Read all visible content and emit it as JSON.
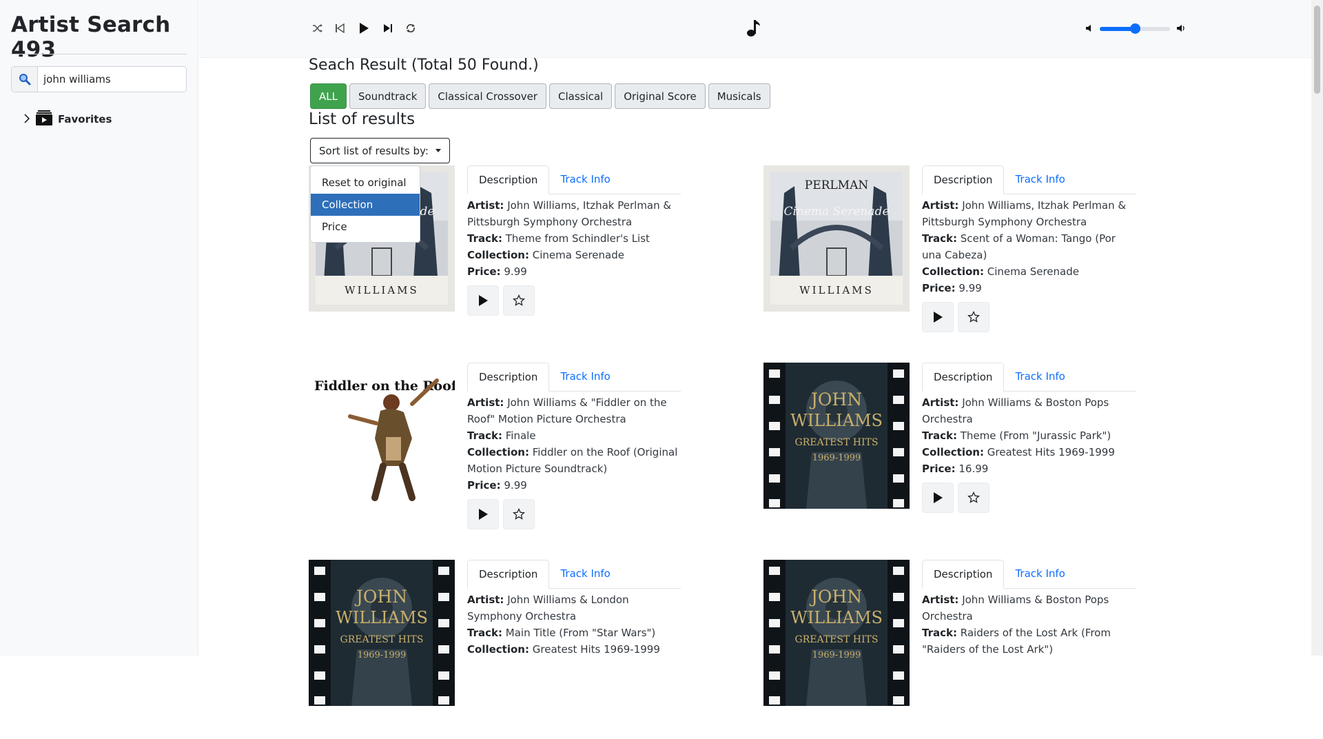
{
  "app": {
    "title": "Artist Search 493"
  },
  "search": {
    "value": "john williams",
    "icon": "search-icon"
  },
  "sidebar": {
    "favorites_label": "Favorites"
  },
  "player": {
    "volume_percent": 50
  },
  "results": {
    "heading": "Seach Result (Total 50 Found.)",
    "list_heading": "List of results",
    "filters": [
      "ALL",
      "Soundtrack",
      "Classical Crossover",
      "Classical",
      "Original Score",
      "Musicals"
    ],
    "active_filter": "ALL",
    "sort": {
      "label": "Sort list of results by:",
      "options": [
        "Reset to original",
        "Collection",
        "Price"
      ],
      "highlighted": "Collection"
    },
    "tab_labels": {
      "description": "Description",
      "track_info": "Track Info"
    },
    "field_labels": {
      "artist": "Artist:",
      "track": "Track:",
      "collection": "Collection:",
      "price": "Price:"
    },
    "cards": [
      {
        "artist": "John Williams, Itzhak Perlman & Pittsburgh Symphony Orchestra",
        "track": "Theme from Schindler's List",
        "collection": "Cinema Serenade",
        "price": "9.99",
        "cover": "cinema-serenade"
      },
      {
        "artist": "John Williams, Itzhak Perlman & Pittsburgh Symphony Orchestra",
        "track": "Scent of a Woman: Tango (Por una Cabeza)",
        "collection": "Cinema Serenade",
        "price": "9.99",
        "cover": "cinema-serenade"
      },
      {
        "artist": "John Williams & \"Fiddler on the Roof\" Motion Picture Orchestra",
        "track": "Finale",
        "collection": "Fiddler on the Roof (Original Motion Picture Soundtrack)",
        "price": "9.99",
        "cover": "fiddler"
      },
      {
        "artist": "John Williams & Boston Pops Orchestra",
        "track": "Theme (From \"Jurassic Park\")",
        "collection": "Greatest Hits 1969-1999",
        "price": "16.99",
        "cover": "greatest-hits"
      },
      {
        "artist": "John Williams & London Symphony Orchestra",
        "track": "Main Title (From \"Star Wars\")",
        "collection": "Greatest Hits 1969-1999",
        "price": "",
        "cover": "greatest-hits"
      },
      {
        "artist": "John Williams & Boston Pops Orchestra",
        "track": "Raiders of the Lost Ark (From \"Raiders of the Lost Ark\")",
        "collection": "",
        "price": "",
        "cover": "greatest-hits"
      }
    ]
  },
  "covers": {
    "cinema-serenade": {
      "top_text": "PERLMAN",
      "script_text": "Cinema Serenade",
      "bottom_text": "WILLIAMS"
    },
    "fiddler": {
      "title": "Fiddler on the Roof"
    },
    "greatest-hits": {
      "line1": "JOHN",
      "line2": "WILLIAMS",
      "line3": "GREATEST HITS",
      "line4": "1969-1999"
    }
  },
  "colors": {
    "active_filter": "#3fa34d",
    "link": "#0d6efd",
    "menu_highlight": "#2e6fba"
  }
}
